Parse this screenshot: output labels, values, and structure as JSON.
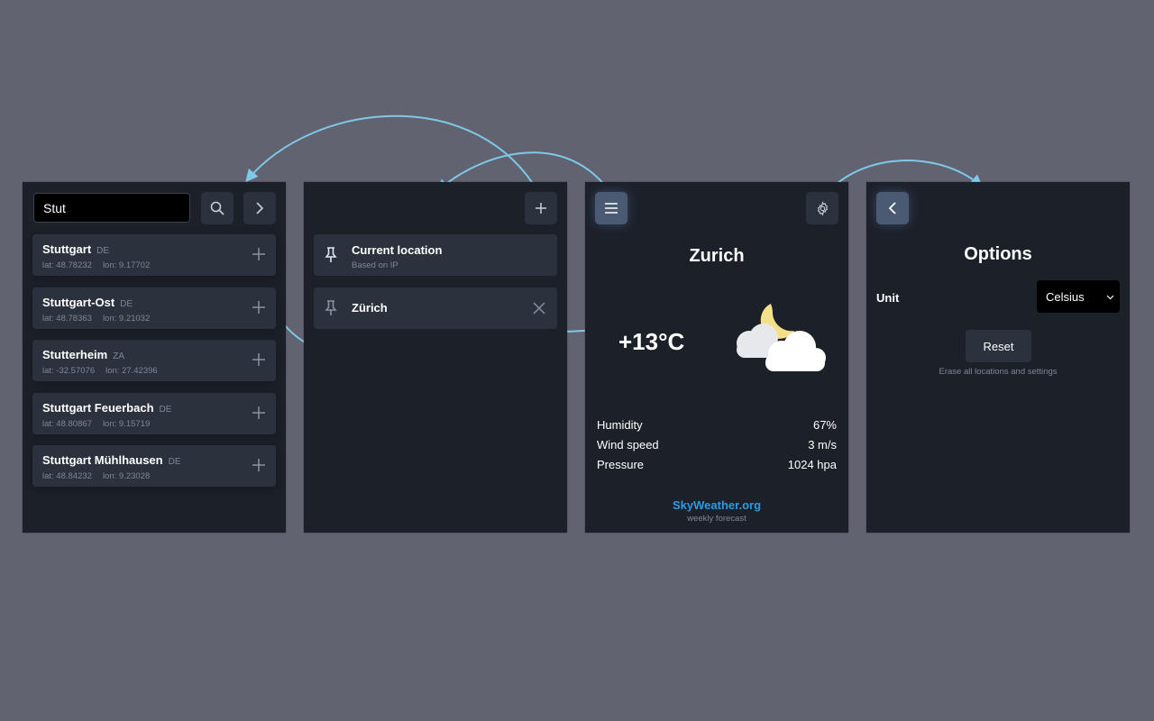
{
  "search_panel": {
    "query": "Stut",
    "results": [
      {
        "name": "Stuttgart",
        "country": "DE",
        "lat": "lat: 48.78232",
        "lon": "lon: 9.17702"
      },
      {
        "name": "Stuttgart-Ost",
        "country": "DE",
        "lat": "lat: 48.78363",
        "lon": "lon: 9.21032"
      },
      {
        "name": "Stutterheim",
        "country": "ZA",
        "lat": "lat: -32.57076",
        "lon": "lon: 27.42396"
      },
      {
        "name": "Stuttgart Feuerbach",
        "country": "DE",
        "lat": "lat: 48.80867",
        "lon": "lon: 9.15719"
      },
      {
        "name": "Stuttgart Mühlhausen",
        "country": "DE",
        "lat": "lat: 48.84232",
        "lon": "lon: 9.23028"
      }
    ]
  },
  "locations_panel": {
    "items": [
      {
        "title": "Current location",
        "subtitle": "Based on IP"
      },
      {
        "title": "Zürich",
        "subtitle": ""
      }
    ]
  },
  "weather_panel": {
    "city": "Zurich",
    "temperature": "+13°C",
    "icon": "partly-cloudy-night-icon",
    "stats": [
      {
        "label": "Humidity",
        "value": "67%"
      },
      {
        "label": "Wind speed",
        "value": "3 m/s"
      },
      {
        "label": "Pressure",
        "value": "1024 hpa"
      }
    ],
    "brand": "SkyWeather.org",
    "brand_sub": "weekly forecast"
  },
  "options_panel": {
    "title": "Options",
    "unit_label": "Unit",
    "unit_value": "Celsius",
    "reset_label": "Reset",
    "reset_hint": "Erase all locations and settings"
  },
  "colors": {
    "background": "#626370",
    "panel": "#1c2029",
    "card": "#2b313d",
    "arrow": "#7ec8ea",
    "brand": "#2e9be0"
  }
}
